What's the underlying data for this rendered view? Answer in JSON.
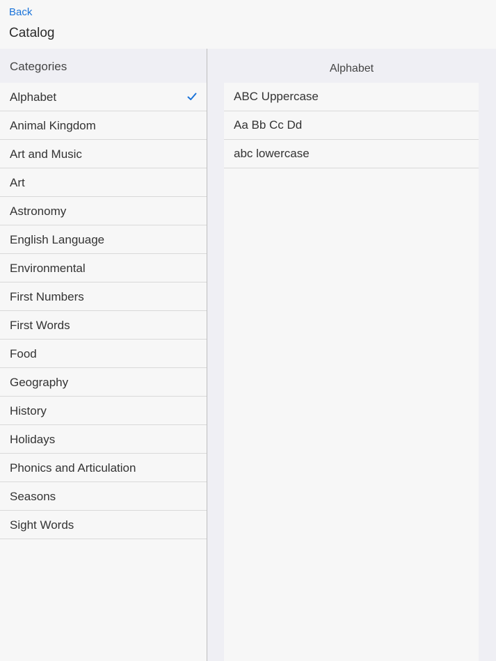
{
  "header": {
    "back_label": "Back",
    "title": "Catalog"
  },
  "sidebar": {
    "title": "Categories",
    "selected_index": 0,
    "items": [
      {
        "label": "Alphabet",
        "selected": true
      },
      {
        "label": "Animal Kingdom"
      },
      {
        "label": "Art and Music"
      },
      {
        "label": "Art"
      },
      {
        "label": "Astronomy"
      },
      {
        "label": "English Language"
      },
      {
        "label": "Environmental"
      },
      {
        "label": "First Numbers"
      },
      {
        "label": "First Words"
      },
      {
        "label": "Food"
      },
      {
        "label": "Geography"
      },
      {
        "label": "History"
      },
      {
        "label": "Holidays"
      },
      {
        "label": "Phonics and Articulation"
      },
      {
        "label": "Seasons"
      },
      {
        "label": "Sight Words"
      }
    ]
  },
  "detail": {
    "title": "Alphabet",
    "items": [
      {
        "label": "ABC Uppercase"
      },
      {
        "label": "Aa Bb Cc Dd"
      },
      {
        "label": "abc lowercase"
      }
    ]
  },
  "icons": {
    "selected_marker": "checkmark-icon"
  },
  "colors": {
    "accent": "#1a73d9",
    "background": "#f7f7f7",
    "section_background": "#efeff4",
    "separator": "#d9d9d9"
  }
}
